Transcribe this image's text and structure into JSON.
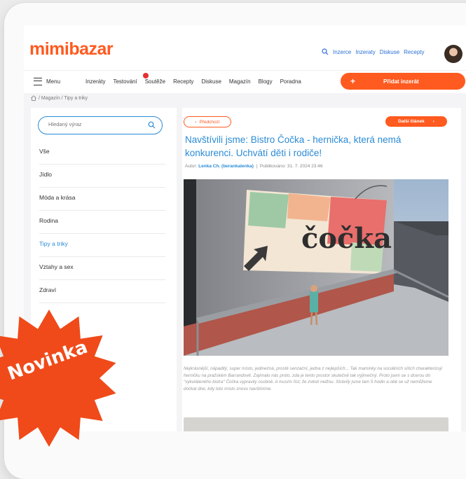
{
  "header": {
    "logo": "mimibazar",
    "links": [
      "Inzerce",
      "Inzeraty",
      "Diskuse",
      "Recepty"
    ]
  },
  "nav": {
    "menu_label": "Menu",
    "links": [
      "Inzeráty",
      "Testování",
      "Soutěže",
      "Recepty",
      "Diskuse",
      "Magazín",
      "Blogy",
      "Poradna"
    ],
    "add_button": "Přidat inzerát"
  },
  "breadcrumb": "/ Magazín / Tipy a triky",
  "sidebar": {
    "search_placeholder": "Hledaný výraz",
    "categories": [
      "Vše",
      "Jídlo",
      "Móda a krása",
      "Rodina",
      "Tipy a triky",
      "Vztahy a sex",
      "Zdraví"
    ],
    "active_category": "Tipy a triky"
  },
  "article": {
    "prev_label": "Předchozí",
    "next_label": "Další článek",
    "title": "Navštívili jsme: Bistro Čočka - hernička, která nemá konkurenci. Uchvátí děti i rodiče!",
    "author_label": "Autor:",
    "author": "Lenka Ch. (berankalenka)",
    "published": "Publikováno: 31. 7. 2024 23:46",
    "photo_sign": "čočka",
    "excerpt": "Nejkrásnější, nápaditý, super místo, jedinečná, prostě senzační, jedna z nejlepších... Tak maminky na sociálních sítích charakterizují herničku na pražském Barrandově. Zajímalo nás proto, zda je tento prostor skutečně tak výjimečný. Proto jsem se s dcerou do \"vykutáleného bistra\" Čočka vypravily osobně. A musím říct, že zvěsti nelžou. Strávily jsme tam 5 hodin a obě se už nemůžeme dočkat dne, kdy toto místo znovu navštívíme."
  },
  "promo": {
    "badge_text": "Novinka",
    "color": "#f04a1a"
  },
  "colors": {
    "accent": "#ff5a1f",
    "link": "#2b8bd6"
  }
}
